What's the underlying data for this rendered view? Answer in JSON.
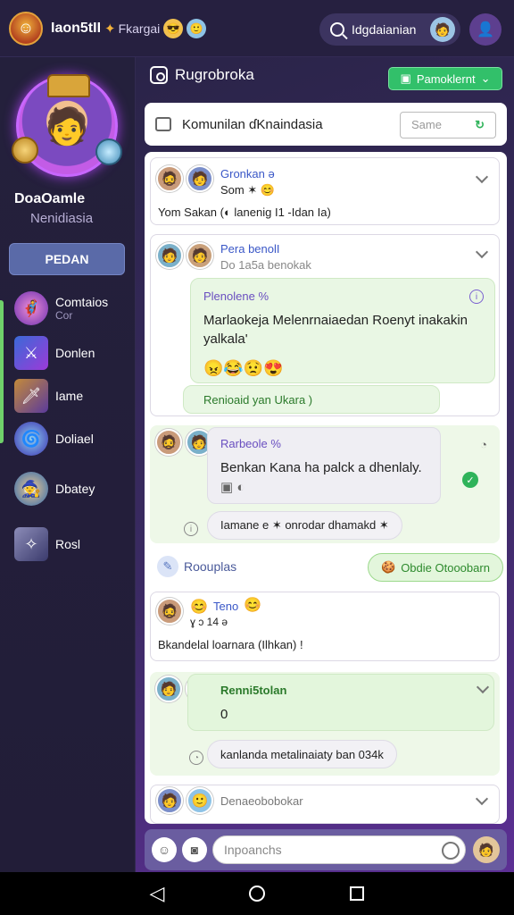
{
  "topbar": {
    "brand": "Iaon5tII",
    "sub": "Fkargai",
    "search_text": "Idgdaianian"
  },
  "sidebar": {
    "name": "DoaOamle",
    "subtitle": "Nenidiasia",
    "button": "PEDAN",
    "items": [
      {
        "label": "Comtaios",
        "sub": "Cor"
      },
      {
        "label": "Donlen",
        "sub": ""
      },
      {
        "label": "Iame",
        "sub": ""
      },
      {
        "label": "Doliael",
        "sub": ""
      },
      {
        "label": "Dbatey",
        "sub": ""
      },
      {
        "label": "Rosl",
        "sub": ""
      }
    ]
  },
  "header": {
    "title": "Rugrobroka",
    "action_button": "Pamoklernt"
  },
  "community": {
    "title": "Komunilan ɗKnaindasia",
    "same_placeholder": "Same"
  },
  "posts": [
    {
      "name": "Gronkan ə",
      "meta": "Som ✶ 😊",
      "text": "Yom Sakan (◐ lanenig I1 -Idan Ia)"
    },
    {
      "name": "Pera benolI",
      "meta": "Do 1a5a benokak",
      "bubble_title": "Plenolene %",
      "bubble_text": "Marlaokeja Melenrnaiaedan Roenyt inakakin yalkala'",
      "emojis": "😠😂😟😍",
      "bubble_footer": "Renioaid yan Ukara )"
    },
    {
      "name": "Rarbeole %",
      "bubble_text": "Benkan Kana ha palck a dhenlaly.",
      "pill_text": "Iamane e ✶ onrodar dhamakd ✶"
    },
    {
      "section_label": "Roouplas",
      "section_button": "Obdie Otooobarn",
      "name": "Teno",
      "meta": "ɣ ɔ 14 ə",
      "text": "Bkandelal loarnara (Ilhkan) !"
    },
    {
      "name": "Renni5tolan",
      "count": "0",
      "pill_text": "kanlanda metalinaiaty ban 034k"
    },
    {
      "name": "Denaeobobokar"
    }
  ],
  "compose": {
    "placeholder": "Inpoanchs"
  }
}
